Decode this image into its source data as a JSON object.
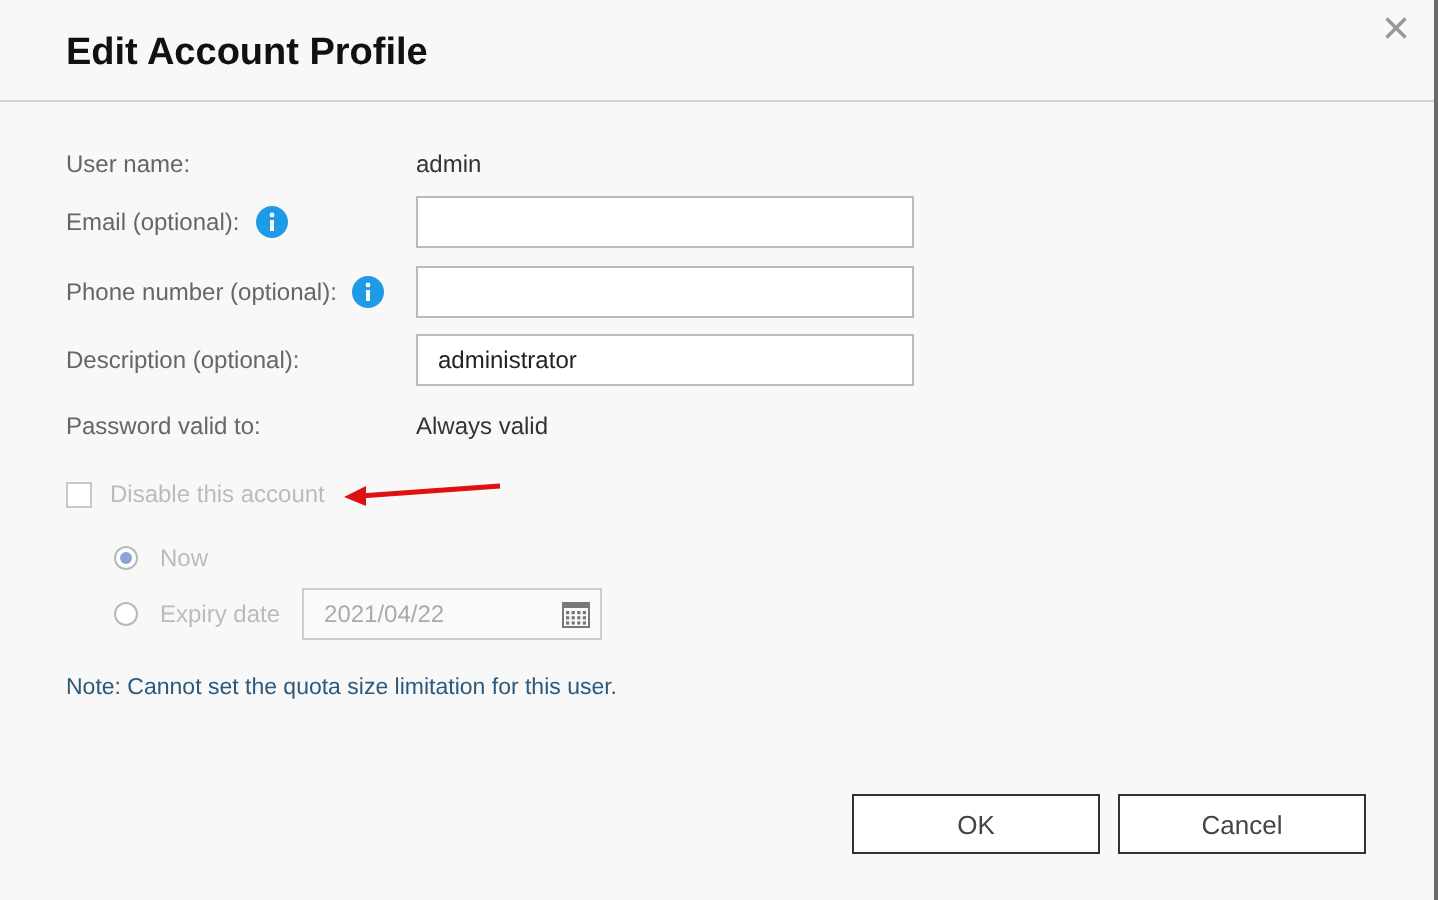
{
  "dialog": {
    "title": "Edit Account Profile",
    "close": "×"
  },
  "fields": [
    {
      "kind": "text",
      "label": "User name:",
      "value": "admin",
      "info": false
    },
    {
      "kind": "input",
      "label": "Email (optional):",
      "info": true
    },
    {
      "kind": "input",
      "label": "Phone number (optional):",
      "info": true
    },
    {
      "kind": "input",
      "label": "Description (optional):",
      "value": "administrator",
      "info": false
    },
    {
      "kind": "text",
      "label": "Password valid to:",
      "value": "Always valid",
      "info": false
    }
  ],
  "disable_account": {
    "label": "Disable this account",
    "checked": false,
    "disabled": true
  },
  "disable_options": [
    {
      "label": "Now",
      "selected": true
    },
    {
      "label": "Expiry date",
      "selected": false,
      "date": "2021/04/22"
    }
  ],
  "note": "Note: Cannot set the quota size limitation for this user.",
  "buttons": [
    "OK",
    "Cancel"
  ]
}
